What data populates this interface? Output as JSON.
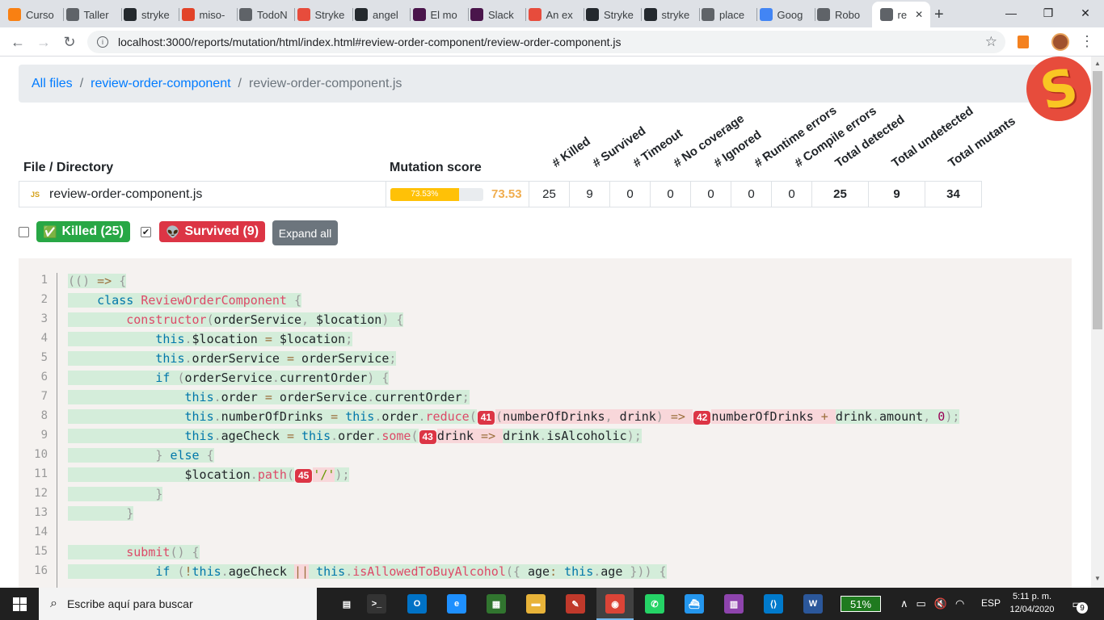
{
  "browser": {
    "tabs": [
      {
        "label": "Curso",
        "icon": "moodle-icon",
        "color": "#f98012"
      },
      {
        "label": "Taller",
        "icon": "book-icon",
        "color": "#5f6368"
      },
      {
        "label": "stryke",
        "icon": "github-icon",
        "color": "#24292e"
      },
      {
        "label": "miso-",
        "icon": "gitlab-icon",
        "color": "#e24329"
      },
      {
        "label": "TodoN",
        "icon": "checkbox-icon",
        "color": "#5f6368"
      },
      {
        "label": "Stryke",
        "icon": "stryker-icon",
        "color": "#e74c3c"
      },
      {
        "label": "angel",
        "icon": "github-icon",
        "color": "#24292e"
      },
      {
        "label": "El mo",
        "icon": "slack-icon",
        "color": "#4a154b"
      },
      {
        "label": "Slack",
        "icon": "slack-icon",
        "color": "#4a154b"
      },
      {
        "label": "An ex",
        "icon": "stryker-icon",
        "color": "#e74c3c"
      },
      {
        "label": "Stryke",
        "icon": "github-icon",
        "color": "#24292e"
      },
      {
        "label": "stryke",
        "icon": "github-icon",
        "color": "#24292e"
      },
      {
        "label": "place",
        "icon": "globe-icon",
        "color": "#5f6368"
      },
      {
        "label": "Goog",
        "icon": "google-docs-icon",
        "color": "#4285f4"
      },
      {
        "label": "Robo",
        "icon": "globe-icon",
        "color": "#5f6368"
      },
      {
        "label": "re",
        "icon": "globe-icon",
        "color": "#5f6368"
      }
    ],
    "new_tab": "+",
    "window": {
      "minimize": "—",
      "maximize": "❐",
      "close": "✕"
    },
    "url": "localhost:3000/reports/mutation/html/index.html#review-order-component/review-order-component.js"
  },
  "breadcrumb": {
    "root": "All files",
    "folder": "review-order-component",
    "file": "review-order-component.js",
    "sep": "/"
  },
  "table": {
    "headers": {
      "file": "File / Directory",
      "score": "Mutation score"
    },
    "rotated_headers": [
      "# Killed",
      "# Survived",
      "# Timeout",
      "# No coverage",
      "# Ignored",
      "# Runtime errors",
      "# Compile errors",
      "Total detected",
      "Total undetected",
      "Total mutants"
    ],
    "row": {
      "icon": "JS",
      "name": "review-order-component.js",
      "score_percent": 73.53,
      "score_bar_label": "73.53%",
      "score_text": "73.53",
      "values": [
        "25",
        "9",
        "0",
        "0",
        "0",
        "0",
        "0",
        "25",
        "9",
        "34"
      ]
    }
  },
  "filters": {
    "killed": {
      "label": "Killed (25)",
      "checked": false,
      "emoji": "✅"
    },
    "survived": {
      "label": "Survived (9)",
      "checked": true,
      "emoji": "👽"
    },
    "expand_all": "Expand all"
  },
  "code": {
    "line_numbers": [
      "1",
      "2",
      "3",
      "4",
      "5",
      "6",
      "7",
      "8",
      "9",
      "10",
      "11",
      "12",
      "13",
      "14",
      "15",
      "16"
    ],
    "mutant_ids": [
      "41",
      "42",
      "43",
      "45"
    ]
  },
  "taskbar": {
    "search_placeholder": "Escribe aquí para buscar",
    "battery": "51%",
    "lang": "ESP",
    "time": "5:11 p. m.",
    "date": "12/04/2020",
    "notifications": "9"
  },
  "colors": {
    "killed": "#28a745",
    "survived": "#dc3545",
    "score": "#f0ad4e",
    "warning_bar": "#ffc107"
  }
}
